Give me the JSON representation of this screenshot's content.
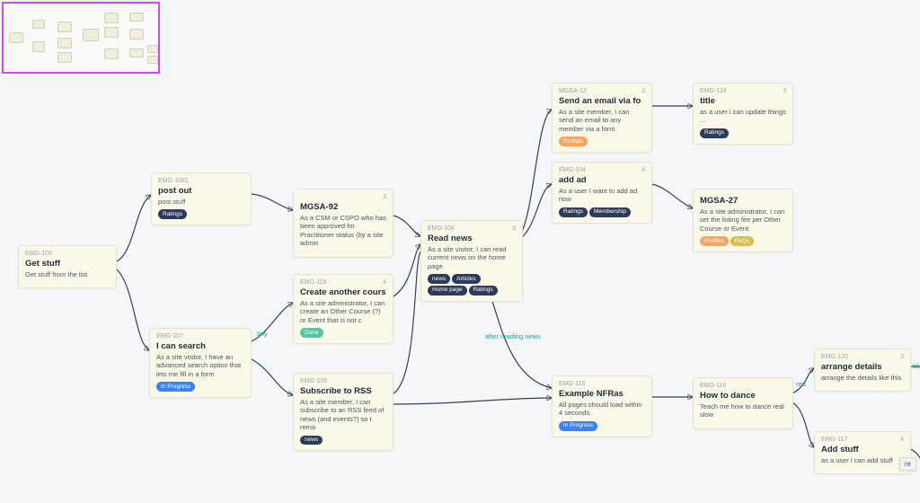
{
  "minimap": {
    "present": true
  },
  "cards": {
    "getStuff": {
      "id": "EMG-109",
      "title": "Get stuff",
      "desc": "Get stuff from the list"
    },
    "postOut": {
      "id": "EMG-1081",
      "title": "post out",
      "desc": "post stuff"
    },
    "iCanSearch": {
      "id": "EMG-107",
      "title": "I can search",
      "desc": "As a site visitor, I have an advanced search option that lets me fill in a form"
    },
    "mgsa92": {
      "id": "MGSA-92",
      "count": "3",
      "title": "MGSA-92",
      "desc": "As a CSM or CSPO who has been approved for Practitioner status (by a site admin"
    },
    "createCourse": {
      "id": "EMG-119",
      "count": "4",
      "title": "Create another cours",
      "desc": "As a site administrator, I can create an Other Course (?) or Event that is not c"
    },
    "subscribe": {
      "id": "EMG-105",
      "title": "Subscribe to RSS",
      "desc": "As a site member, I can subscribe to an RSS feed of news (and events?) so I rema"
    },
    "readNews": {
      "id": "EMG-106",
      "count": "3",
      "title": "Read news",
      "desc": "As a site visitor, I can read current news on the home page"
    },
    "sendEmail": {
      "id": "MGSA-12",
      "count": "3",
      "title": "Send an email via fo",
      "desc": "As a site member, I can send an email to any member via a form."
    },
    "addAd": {
      "id": "EMG-104",
      "count": "4",
      "title": "add ad",
      "desc": "As a user I want to add ad now"
    },
    "exampleNfr": {
      "id": "EMG-118",
      "title": "Example NFRas",
      "desc": "All pages should load within 4 seconds."
    },
    "titleCard": {
      "id": "EMG-124",
      "count": "3",
      "title": "title",
      "desc": "as a user i can update things ..."
    },
    "mgsa27": {
      "id": "MGSA-27",
      "title": "MGSA-27",
      "desc": "As a site administrator, I can set the listing fee per Other Course or Event"
    },
    "howToDance": {
      "id": "EMG-116",
      "title": "How to dance",
      "desc": "Teach me how to dance real slow"
    },
    "arrange": {
      "id": "EMG-120",
      "count": "3",
      "title": "arrange details",
      "desc": "arrange the details like this"
    },
    "addStuff": {
      "id": "EMG-117",
      "count": "4",
      "title": "Add stuff",
      "desc": "as a user i can add stuff"
    }
  },
  "tags": {
    "ratings": {
      "label": "Ratings",
      "color": "dark"
    },
    "inProgress": {
      "label": "In Progress",
      "color": "blue"
    },
    "done": {
      "label": "Done",
      "color": "green"
    },
    "news": {
      "label": "news",
      "color": "dark"
    },
    "articles": {
      "label": "Articles",
      "color": "dark"
    },
    "homePage": {
      "label": "Home page",
      "color": "dark"
    },
    "profiles": {
      "label": "Profiles",
      "color": "orange"
    },
    "membership": {
      "label": "Membership",
      "color": "dark"
    },
    "faqs": {
      "label": "FAQs",
      "color": "yellow"
    }
  },
  "edgeLabels": {
    "tiny": "tiny",
    "afterReading": "after reading news",
    "red": "red",
    "blue": "blue",
    "re": "re"
  },
  "tooltip": {
    "text": "re"
  }
}
